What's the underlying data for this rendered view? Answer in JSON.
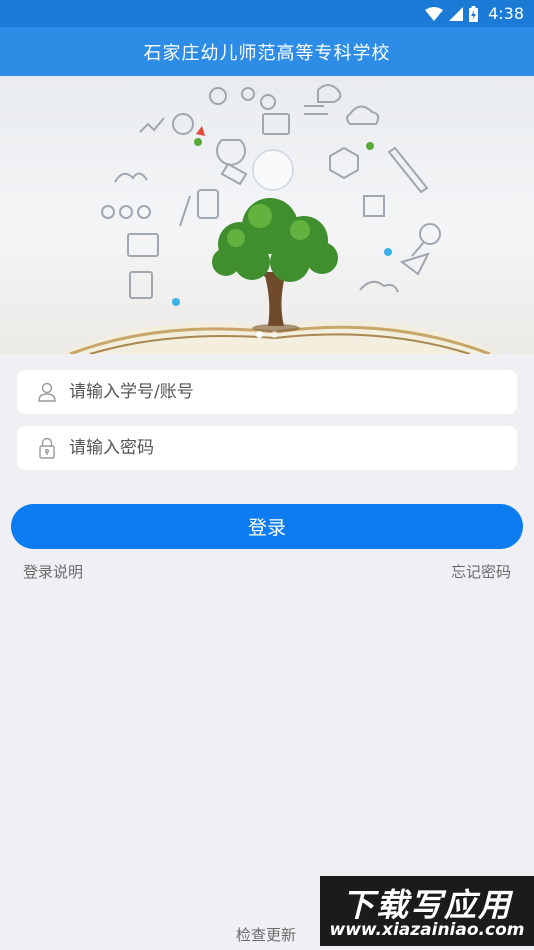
{
  "status_bar": {
    "time": "4:38",
    "icons": [
      "wifi-icon",
      "signal-icon",
      "battery-icon"
    ]
  },
  "app_bar": {
    "title": "石家庄幼儿师范高等专科学校"
  },
  "banner": {
    "slide_count": 2,
    "active_slide": 1
  },
  "login_form": {
    "username_placeholder": "请输入学号/账号",
    "password_placeholder": "请输入密码",
    "login_label": "登录"
  },
  "links": {
    "help": "登录说明",
    "forgot": "忘记密码",
    "check_update": "检查更新"
  },
  "watermark": {
    "title": "下载写应用",
    "url": "www.xiazainiao.com"
  },
  "colors": {
    "status_bar": "#1a7ad6",
    "app_bar": "#2c8ce6",
    "primary_button": "#0d7cf0",
    "background": "#efeff4"
  }
}
